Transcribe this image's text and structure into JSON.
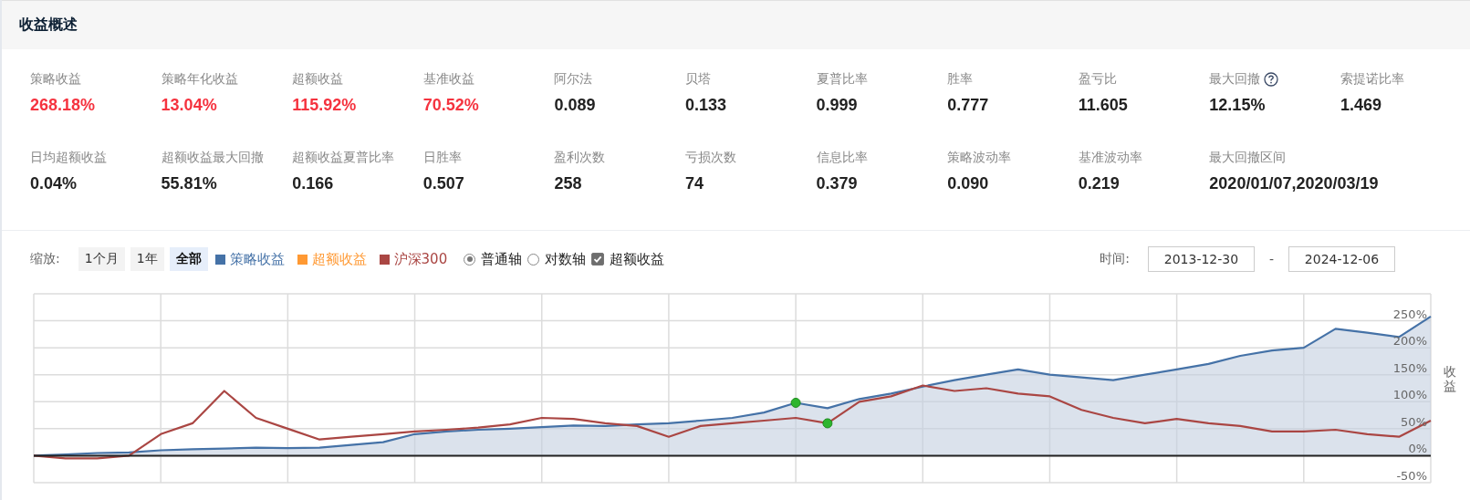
{
  "header": {
    "title": "收益概述"
  },
  "metrics": [
    [
      {
        "label": "策略收益",
        "value": "268.18%",
        "color": "#f5333f",
        "help": false
      },
      {
        "label": "策略年化收益",
        "value": "13.04%",
        "color": "#f5333f",
        "help": false
      },
      {
        "label": "超额收益",
        "value": "115.92%",
        "color": "#f5333f",
        "help": false
      },
      {
        "label": "基准收益",
        "value": "70.52%",
        "color": "#f5333f",
        "help": false
      },
      {
        "label": "阿尔法",
        "value": "0.089",
        "color": "#222222",
        "help": false
      },
      {
        "label": "贝塔",
        "value": "0.133",
        "color": "#222222",
        "help": false
      },
      {
        "label": "夏普比率",
        "value": "0.999",
        "color": "#222222",
        "help": false
      },
      {
        "label": "胜率",
        "value": "0.777",
        "color": "#222222",
        "help": false
      },
      {
        "label": "盈亏比",
        "value": "11.605",
        "color": "#222222",
        "help": false
      },
      {
        "label": "最大回撤",
        "value": "12.15%",
        "color": "#222222",
        "help": true
      },
      {
        "label": "索提诺比率",
        "value": "1.469",
        "color": "#222222",
        "help": false
      }
    ],
    [
      {
        "label": "日均超额收益",
        "value": "0.04%",
        "color": "#222222",
        "help": false
      },
      {
        "label": "超额收益最大回撤",
        "value": "55.81%",
        "color": "#222222",
        "help": false
      },
      {
        "label": "超额收益夏普比率",
        "value": "0.166",
        "color": "#222222",
        "help": false
      },
      {
        "label": "日胜率",
        "value": "0.507",
        "color": "#222222",
        "help": false
      },
      {
        "label": "盈利次数",
        "value": "258",
        "color": "#222222",
        "help": false
      },
      {
        "label": "亏损次数",
        "value": "74",
        "color": "#222222",
        "help": false
      },
      {
        "label": "信息比率",
        "value": "0.379",
        "color": "#222222",
        "help": false
      },
      {
        "label": "策略波动率",
        "value": "0.090",
        "color": "#222222",
        "help": false
      },
      {
        "label": "基准波动率",
        "value": "0.219",
        "color": "#222222",
        "help": false
      },
      {
        "label": "最大回撤区间",
        "value": "2020/01/07,2020/03/19",
        "color": "#222222",
        "help": false
      }
    ]
  ],
  "toolbar": {
    "zoom_label": "缩放:",
    "zoom_buttons": [
      {
        "label": "1个月",
        "selected": false
      },
      {
        "label": "1年",
        "selected": false
      },
      {
        "label": "全部",
        "selected": true
      }
    ],
    "legend": [
      {
        "label": "策略收益",
        "color": "#4572a7"
      },
      {
        "label": "超额收益",
        "color": "#ff9933"
      },
      {
        "label": "沪深300",
        "color": "#aa4643"
      }
    ],
    "axis_options": [
      {
        "label": "普通轴",
        "selected": true
      },
      {
        "label": "对数轴",
        "selected": false
      }
    ],
    "excess_toggle": {
      "label": "超额收益",
      "checked": true
    },
    "time_label": "时间:",
    "date_from": "2013-12-30",
    "date_separator": "-",
    "date_to": "2024-12-06"
  },
  "chart": {
    "chart_data": {
      "type": "line",
      "ylabel": "收益",
      "ylim": [
        -50,
        300
      ],
      "grid": true,
      "yticks": [
        {
          "value": -50,
          "label": "-50%"
        },
        {
          "value": 0,
          "label": "0%"
        },
        {
          "value": 50,
          "label": "50%"
        },
        {
          "value": 100,
          "label": "100%"
        },
        {
          "value": 150,
          "label": "150%"
        },
        {
          "value": 200,
          "label": "200%"
        },
        {
          "value": 250,
          "label": "250%"
        }
      ],
      "series": [
        {
          "type": "area",
          "color": "#4572a7",
          "values": [
            0,
            2,
            5,
            6,
            10,
            12,
            13,
            15,
            14,
            15,
            20,
            25,
            40,
            45,
            48,
            50,
            53,
            56,
            55,
            58,
            60,
            65,
            70,
            80,
            98,
            88,
            105,
            115,
            128,
            140,
            150,
            160,
            150,
            145,
            140,
            150,
            160,
            170,
            185,
            195,
            200,
            235,
            228,
            220,
            258
          ]
        },
        {
          "type": "line",
          "color": "#aa4643",
          "values": [
            0,
            -5,
            -5,
            0,
            40,
            60,
            120,
            70,
            50,
            30,
            35,
            40,
            45,
            48,
            52,
            58,
            70,
            68,
            60,
            55,
            35,
            55,
            60,
            65,
            70,
            60,
            100,
            110,
            130,
            120,
            125,
            115,
            110,
            85,
            70,
            60,
            68,
            60,
            55,
            45,
            45,
            48,
            40,
            35,
            65
          ]
        }
      ]
    }
  }
}
